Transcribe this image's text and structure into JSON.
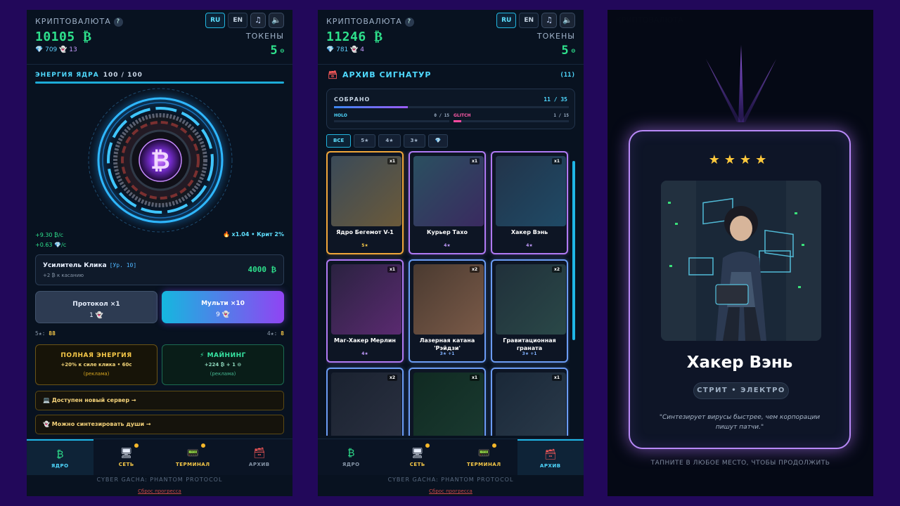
{
  "colors": {
    "background": "#22085a",
    "accent_cyan": "#4fd9ff",
    "accent_green": "#2ee08c",
    "gold": "#f7c948",
    "purple": "#9b5cf6"
  },
  "header": {
    "currency_label": "КРИПТОВАЛЮТА",
    "help_icon": "?",
    "lang_ru": "RU",
    "lang_en": "EN",
    "music_icon": "music-icon",
    "sound_icon": "speaker-icon",
    "tokens_label": "ТОКЕНЫ"
  },
  "phone1": {
    "balance": "10105 ₿",
    "gems": "709",
    "souls": "13",
    "tokens": "5",
    "energy_label": "ЭНЕРГИЯ ЯДРА",
    "energy_value": "100 / 100",
    "energy_fraction": 1.0,
    "core_symbol": "₿",
    "rate_btc": "+9.30 ₿/с",
    "rate_gems": "+0.63 💎/с",
    "multiplier": "x1.04 • Крит 2%",
    "booster": {
      "name": "Усилитель Клика",
      "level": "[Ур. 10]",
      "desc": "+2 ₿ к касанию",
      "price": "4000 ₿"
    },
    "protocol_btn": {
      "title": "Протокол ×1",
      "cost": "1 👻"
    },
    "multi_btn": {
      "title": "Мульти ×10",
      "cost": "9 👻"
    },
    "pity_5": {
      "label": "5★:",
      "value": "88"
    },
    "pity_4": {
      "label": "4★:",
      "value": "8"
    },
    "full_energy": {
      "title": "ПОЛНАЯ ЭНЕРГИЯ",
      "sub": "+20% к силе клика • 60с",
      "ad": "(реклама)"
    },
    "mining": {
      "title": "⚡ МАЙНИНГ",
      "sub": "+224 ₿ + 1 ⊖",
      "ad": "(реклама)"
    },
    "notice_server": "💻 Доступен новый сервер →",
    "notice_souls": "👻 Можно синтезировать души →"
  },
  "phone2": {
    "balance": "11246 ₿",
    "gems": "781",
    "souls": "4",
    "tokens": "5",
    "archive_title": "АРХИВ СИГНАТУР",
    "archive_count": "(11)",
    "collected_label": "СОБРАНО",
    "collected_value": "11 / 35",
    "collected_fraction": 0.314,
    "holo_label": "HOLO",
    "holo_value": "0 / 15",
    "glitch_label": "GLITCH",
    "glitch_value": "1 / 15",
    "glitch_fraction": 0.067,
    "filters": [
      "ВСЕ",
      "5★",
      "4★",
      "3★",
      "💎"
    ],
    "cards": [
      {
        "name": "Ядро Бегемот V-1",
        "stars": "5★",
        "qty": "x1",
        "color": "#f0a63a"
      },
      {
        "name": "Курьер Тахо",
        "stars": "4★",
        "qty": "x1",
        "color": "#b07af5"
      },
      {
        "name": "Хакер Вэнь",
        "stars": "4★",
        "qty": "x1",
        "color": "#b07af5"
      },
      {
        "name": "Маг-Хакер Мерлин",
        "stars": "4★",
        "qty": "x1",
        "color": "#b07af5"
      },
      {
        "name": "Лазерная катана 'Рэйдзи'",
        "stars": "3★ +1",
        "qty": "x2",
        "color": "#6b9cf5"
      },
      {
        "name": "Гравитационная граната",
        "stars": "3★ +1",
        "qty": "x2",
        "color": "#6b9cf5"
      },
      {
        "name": "",
        "stars": "",
        "qty": "x2",
        "color": "#6b9cf5"
      },
      {
        "name": "",
        "stars": "",
        "qty": "x1",
        "color": "#6b9cf5"
      },
      {
        "name": "",
        "stars": "",
        "qty": "x1",
        "color": "#6b9cf5"
      }
    ]
  },
  "phone3": {
    "stars": "★★★★",
    "name": "Хакер Вэнь",
    "tag": "СТРИТ • ЭЛЕКТРО",
    "quote": "\"Синтезирует вирусы быстрее, чем корпорации пишут патчи.\"",
    "tap_hint": "ТАПНИТЕ В ЛЮБОЕ МЕСТО, ЧТОБЫ ПРОДОЛЖИТЬ"
  },
  "tabs": [
    {
      "label": "ЯДРО",
      "icon": "₿"
    },
    {
      "label": "СЕТЬ",
      "icon": "🖥"
    },
    {
      "label": "ТЕРМИНАЛ",
      "icon": "📟"
    },
    {
      "label": "АРХИВ",
      "icon": "🗃"
    }
  ],
  "footer": {
    "title": "CYBER GACHA: PHANTOM PROTOCOL",
    "reset": "Сброс прогресса"
  }
}
